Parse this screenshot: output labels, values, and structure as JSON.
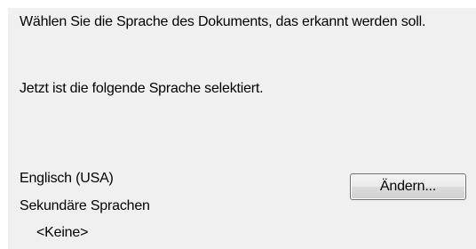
{
  "dialog": {
    "description": "Wählen Sie die Sprache des Dokuments, das erkannt werden soll.",
    "current_label": "Jetzt ist die folgende Sprache selektiert.",
    "selected_language": "Englisch (USA)",
    "secondary_label": "Sekundäre Sprachen",
    "secondary_value": "<Keine>",
    "change_button_label": "Ändern..."
  }
}
